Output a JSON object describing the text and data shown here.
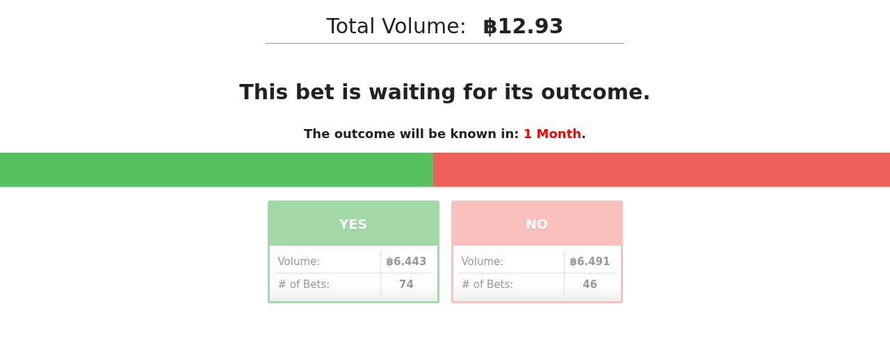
{
  "total_volume": {
    "label": "Total Volume:",
    "value": "฿12.93"
  },
  "status_heading": "This bet is waiting for its outcome.",
  "outcome_notice": {
    "text": "The outcome will be known in: ",
    "time": "1 Month",
    "end": "."
  },
  "split_bar": {
    "level": 0.487
  },
  "sides": [
    {
      "title": "YES",
      "color": "#a3d9a7",
      "rows": [
        {
          "label": "Volume:",
          "value": "฿6.443"
        },
        {
          "label": "# of Bets:",
          "value": "74"
        }
      ]
    },
    {
      "title": "NO",
      "color": "#f9c0bd",
      "rows": [
        {
          "label": "Volume:",
          "value": "฿6.491"
        },
        {
          "label": "# of Bets:",
          "value": "46"
        }
      ]
    }
  ]
}
